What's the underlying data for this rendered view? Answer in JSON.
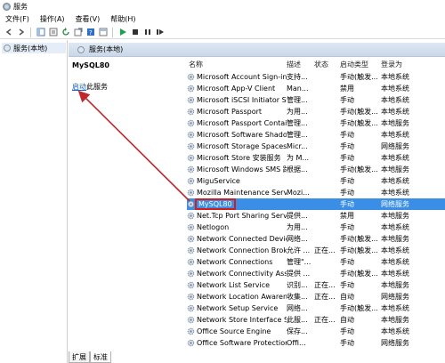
{
  "window": {
    "title": "服务"
  },
  "menu": [
    "文件(F)",
    "操作(A)",
    "查看(V)",
    "帮助(H)"
  ],
  "toolbar": {
    "icons": [
      "back-icon",
      "forward-icon",
      "console-tree-icon",
      "properties-icon",
      "refresh-icon",
      "export-icon",
      "help-icon",
      "view-icon",
      "play-icon",
      "stop-icon",
      "pause-icon",
      "restart-icon"
    ],
    "accent_play": "#1aa34a"
  },
  "tree": {
    "root_label": "服务(本地)"
  },
  "main": {
    "header_label": "服务(本地)",
    "service_title": "MySQL80",
    "start_link": "启动",
    "start_suffix": "此服务"
  },
  "columns": {
    "name": "名称",
    "desc": "描述",
    "status": "状态",
    "start": "启动类型",
    "logon": "登录为"
  },
  "services": [
    {
      "name": "Microsoft Account Sign-in ...",
      "desc": "支持...",
      "status": "",
      "start": "手动(触发...",
      "logon": "本地系统"
    },
    {
      "name": "Microsoft App-V Client",
      "desc": "Man...",
      "status": "",
      "start": "禁用",
      "logon": "本地系统"
    },
    {
      "name": "Microsoft iSCSI Initiator Ser...",
      "desc": "管理...",
      "status": "",
      "start": "手动",
      "logon": "本地系统"
    },
    {
      "name": "Microsoft Passport",
      "desc": "为用...",
      "status": "",
      "start": "手动(触发...",
      "logon": "本地系统"
    },
    {
      "name": "Microsoft Passport Container",
      "desc": "管理...",
      "status": "",
      "start": "手动(触发...",
      "logon": "本地服务"
    },
    {
      "name": "Microsoft Software Shado...",
      "desc": "管理...",
      "status": "",
      "start": "手动",
      "logon": "本地系统"
    },
    {
      "name": "Microsoft Storage Spaces S...",
      "desc": "Micr...",
      "status": "",
      "start": "手动",
      "logon": "网络服务"
    },
    {
      "name": "Microsoft Store 安装服务",
      "desc": "为 M...",
      "status": "",
      "start": "手动",
      "logon": "本地系统"
    },
    {
      "name": "Microsoft Windows SMS 路...",
      "desc": "根据...",
      "status": "",
      "start": "手动(触发...",
      "logon": "本地服务"
    },
    {
      "name": "MiguService",
      "desc": "",
      "status": "",
      "start": "手动",
      "logon": "本地系统"
    },
    {
      "name": "Mozilla Maintenance Service",
      "desc": "Mozi...",
      "status": "",
      "start": "手动",
      "logon": "本地系统"
    },
    {
      "name": "MySQL80",
      "desc": "",
      "status": "",
      "start": "手动",
      "logon": "网络服务"
    },
    {
      "name": "Net.Tcp Port Sharing Service",
      "desc": "提供...",
      "status": "",
      "start": "禁用",
      "logon": "本地服务"
    },
    {
      "name": "Netlogon",
      "desc": "为用...",
      "status": "",
      "start": "手动",
      "logon": "本地系统"
    },
    {
      "name": "Network Connected Devic...",
      "desc": "网络...",
      "status": "",
      "start": "手动(触发...",
      "logon": "本地服务"
    },
    {
      "name": "Network Connection Broker",
      "desc": "允许 ...",
      "status": "正在...",
      "start": "手动(触发...",
      "logon": "本地系统"
    },
    {
      "name": "Network Connections",
      "desc": "管理\"...",
      "status": "",
      "start": "手动",
      "logon": "本地系统"
    },
    {
      "name": "Network Connectivity Assis...",
      "desc": "提供 ...",
      "status": "",
      "start": "手动(触发...",
      "logon": "本地系统"
    },
    {
      "name": "Network List Service",
      "desc": "识别...",
      "status": "正在...",
      "start": "手动",
      "logon": "本地服务"
    },
    {
      "name": "Network Location Awarene...",
      "desc": "收集...",
      "status": "正在...",
      "start": "自动",
      "logon": "网络服务"
    },
    {
      "name": "Network Setup Service",
      "desc": "网络...",
      "status": "",
      "start": "手动(触发...",
      "logon": "本地系统"
    },
    {
      "name": "Network Store Interface Se...",
      "desc": "此服...",
      "status": "正在...",
      "start": "自动",
      "logon": "本地服务"
    },
    {
      "name": "Office  Source Engine",
      "desc": "保存...",
      "status": "",
      "start": "手动",
      "logon": "本地系统"
    },
    {
      "name": "Office Software Protection ...",
      "desc": "Offi...",
      "status": "",
      "start": "手动",
      "logon": "网络服务"
    }
  ],
  "selected_service": "MySQL80",
  "tabs": [
    "扩展",
    "标准"
  ],
  "annotation_color": "#c0282d"
}
